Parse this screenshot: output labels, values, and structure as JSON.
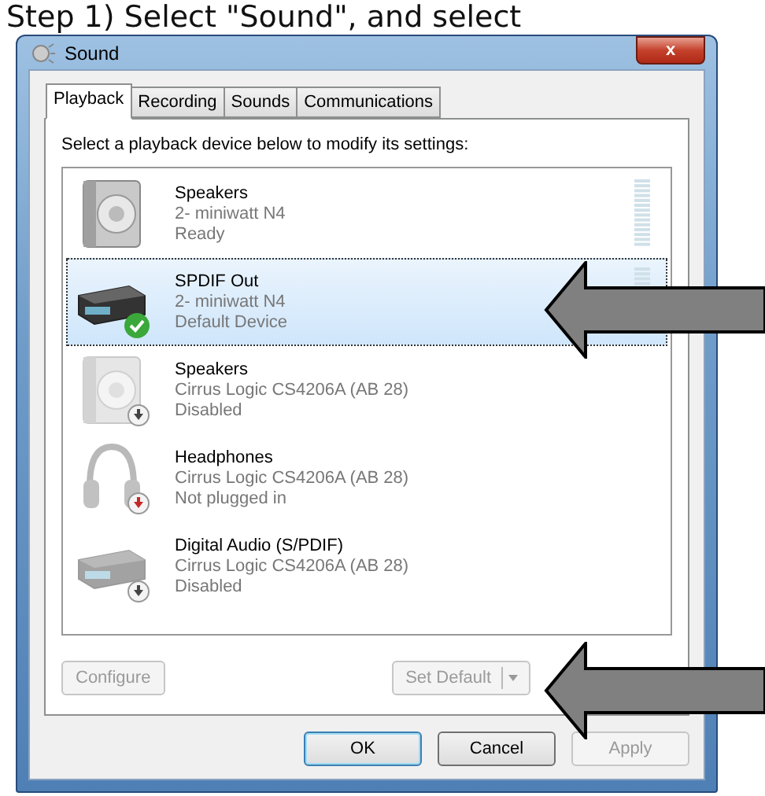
{
  "caption": "Step 1) Select \"Sound\", and select",
  "window": {
    "title": "Sound",
    "close": "x"
  },
  "tabs": [
    {
      "label": "Playback",
      "selected": true
    },
    {
      "label": "Recording",
      "selected": false
    },
    {
      "label": "Sounds",
      "selected": false
    },
    {
      "label": "Communications",
      "selected": false
    }
  ],
  "instruction": "Select a playback device below to modify its settings:",
  "devices": [
    {
      "name": "Speakers",
      "detail": "2- miniwatt N4",
      "status": "Ready",
      "kind": "speaker",
      "default": false,
      "unplugged": false,
      "disabled": false,
      "meter": true,
      "selected": false
    },
    {
      "name": "SPDIF Out",
      "detail": "2- miniwatt N4",
      "status": "Default Device",
      "kind": "receiver",
      "default": true,
      "unplugged": false,
      "disabled": false,
      "meter": true,
      "selected": true
    },
    {
      "name": "Speakers",
      "detail": "Cirrus Logic CS4206A (AB 28)",
      "status": "Disabled",
      "kind": "speaker",
      "default": false,
      "unplugged": false,
      "disabled": true,
      "meter": false,
      "selected": false
    },
    {
      "name": "Headphones",
      "detail": "Cirrus Logic CS4206A (AB 28)",
      "status": "Not plugged in",
      "kind": "headphones",
      "default": false,
      "unplugged": true,
      "disabled": true,
      "meter": false,
      "selected": false
    },
    {
      "name": "Digital Audio (S/PDIF)",
      "detail": "Cirrus Logic CS4206A (AB 28)",
      "status": "Disabled",
      "kind": "receiver",
      "default": false,
      "unplugged": false,
      "disabled": true,
      "meter": false,
      "selected": false
    }
  ],
  "panel_buttons": [
    {
      "label": "Configure",
      "kind": "plain",
      "disabled": true
    },
    {
      "label": "Set Default",
      "kind": "split",
      "disabled": true
    }
  ],
  "dialog_buttons": [
    {
      "label": "OK",
      "disabled": false,
      "default": true
    },
    {
      "label": "Cancel",
      "disabled": false,
      "default": false
    },
    {
      "label": "Apply",
      "disabled": true,
      "default": false
    }
  ],
  "annotations": [
    {
      "kind": "arrow"
    },
    {
      "kind": "arrow"
    }
  ]
}
